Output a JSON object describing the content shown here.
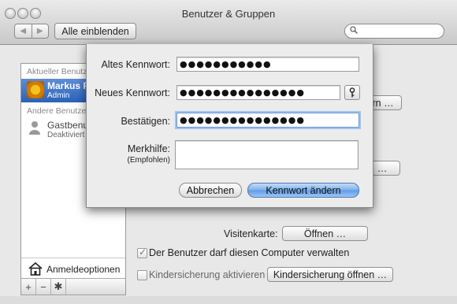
{
  "window": {
    "title": "Benutzer & Gruppen"
  },
  "toolbar": {
    "show_all_label": "Alle einblenden",
    "back_icon": "◀",
    "forward_icon": "▶"
  },
  "sidebar": {
    "current_user_section": "Aktueller Benutzer",
    "current_user": {
      "name": "Markus F…",
      "role": "Admin"
    },
    "other_users_section": "Andere Benutzer",
    "guest_user": {
      "name": "Gastbenutzer",
      "role": "Deaktiviert"
    },
    "login_options_label": "Anmeldeoptionen",
    "add_label": "+",
    "remove_label": "−",
    "gear_label": "✱"
  },
  "main": {
    "button_change_password": "Kennwort ändern …",
    "button_open": "…",
    "visitenkarte_label": "Visitenkarte:",
    "visitenkarte_button": "Öffnen …",
    "admin_checkbox_label": "Der Benutzer darf diesen Computer verwalten",
    "admin_checked": true,
    "parental_checkbox_label": "Kindersicherung aktivieren",
    "parental_checked": false,
    "parental_button": "Kindersicherung öffnen …"
  },
  "sheet": {
    "old_password_label": "Altes Kennwort:",
    "old_password_value": "●●●●●●●●●●●",
    "new_password_label": "Neues Kennwort:",
    "new_password_value": "●●●●●●●●●●●●●●●",
    "confirm_label": "Bestätigen:",
    "confirm_value": "●●●●●●●●●●●●●●●",
    "hint_label": "Merkhilfe:",
    "hint_sub_label": "(Empfohlen)",
    "cancel_label": "Abbrechen",
    "submit_label": "Kennwort ändern"
  }
}
